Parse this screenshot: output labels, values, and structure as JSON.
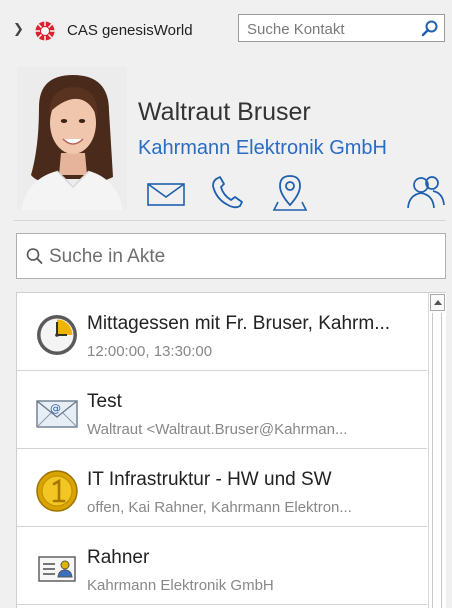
{
  "header": {
    "app_name": "CAS genesisWorld",
    "search_contact_placeholder": "Suche Kontakt"
  },
  "contact": {
    "name": "Waltraut Bruser",
    "company": "Kahrmann Elektronik GmbH"
  },
  "file_search": {
    "placeholder": "Suche in Akte"
  },
  "items": [
    {
      "icon": "appointment-clock-icon",
      "title": "Mittagessen mit Fr. Bruser, Kahrm...",
      "subtitle": "12:00:00, 13:30:00"
    },
    {
      "icon": "email-envelope-icon",
      "title": "Test",
      "subtitle": "Waltraut <Waltraut.Bruser@Kahrman..."
    },
    {
      "icon": "gold-coin-icon",
      "title": "IT Infrastruktur - HW und SW",
      "subtitle": "offen, Kai Rahner, Kahrmann Elektron..."
    },
    {
      "icon": "address-card-icon",
      "title": "Rahner",
      "subtitle": "Kahrmann Elektronik GmbH"
    }
  ],
  "colors": {
    "link_blue": "#2a6cc4",
    "background": "#f0f0f0",
    "secondary_text": "#888888"
  }
}
